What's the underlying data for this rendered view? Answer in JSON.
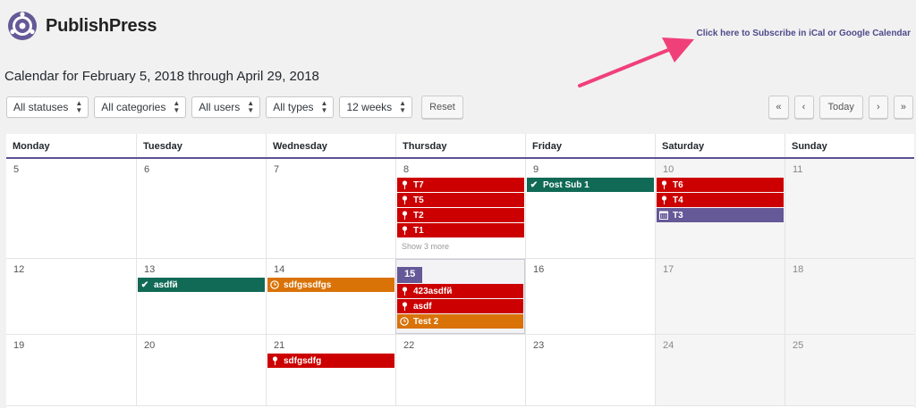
{
  "brand": {
    "name": "PublishPress"
  },
  "subscribe_link": "Click here to Subscribe in iCal or Google Calendar",
  "calendar_title": "Calendar for February 5, 2018 through April 29, 2018",
  "filters": {
    "statuses": "All statuses",
    "categories": "All categories",
    "users": "All users",
    "types": "All types",
    "weeks": "12 weeks",
    "reset": "Reset"
  },
  "nav": {
    "first": "«",
    "prev": "‹",
    "today": "Today",
    "next": "›",
    "last": "»"
  },
  "days": [
    "Monday",
    "Tuesday",
    "Wednesday",
    "Thursday",
    "Friday",
    "Saturday",
    "Sunday"
  ],
  "weeks": [
    {
      "dates": [
        "5",
        "6",
        "7",
        "8",
        "9",
        "10",
        "11"
      ],
      "thursday_items": [
        "T7",
        "T5",
        "T2",
        "T1"
      ],
      "thursday_more": "Show 3 more",
      "friday_items": [
        "Post Sub 1"
      ],
      "saturday_items": [
        "T6",
        "T4",
        "T3"
      ]
    },
    {
      "dates": [
        "12",
        "13",
        "14",
        "15",
        "16",
        "17",
        "18"
      ],
      "tuesday_items": [
        "asdfй"
      ],
      "wednesday_items": [
        "sdfgssdfgs"
      ],
      "thursday_items": [
        "423asdfй",
        "asdf",
        "Test 2"
      ]
    },
    {
      "dates": [
        "19",
        "20",
        "21",
        "22",
        "23",
        "24",
        "25"
      ],
      "wednesday_items": [
        "sdfgsdfg"
      ]
    }
  ],
  "colors": {
    "accent": "#655997",
    "red": "#cc0000",
    "green": "#106a56",
    "orange": "#d97207",
    "arrow": "#f0407a"
  },
  "icons": {
    "pin": "pushpin-icon",
    "check": "checkmark-icon",
    "clock": "clock-icon",
    "calendar": "calendar-icon"
  }
}
